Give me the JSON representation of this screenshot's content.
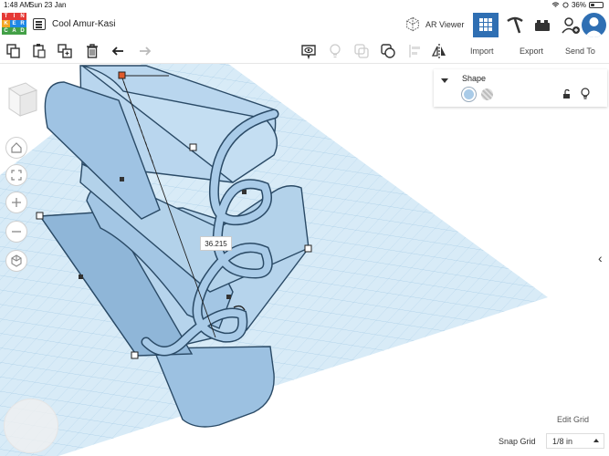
{
  "status_bar": {
    "time": "1:48 AM",
    "date": "Sun 23 Jan",
    "battery": "36%",
    "battery_level": 0.36
  },
  "header": {
    "logo_letters": [
      "T",
      "I",
      "N",
      "K",
      "E",
      "R",
      "C",
      "A",
      "D"
    ],
    "design_name": "Cool Amur-Kasi",
    "ar_viewer_label": "AR Viewer"
  },
  "toolbar": {
    "import_label": "Import",
    "export_label": "Export",
    "send_to_label": "Send To"
  },
  "shape_panel": {
    "title": "Shape"
  },
  "workplane": {
    "measurement": "36.215",
    "edit_grid_label": "Edit Grid",
    "snap_grid_label": "Snap Grid",
    "snap_grid_value": "1/8 in"
  },
  "colors": {
    "accent": "#2f6fb3",
    "shape_fill": "#a9cbe8",
    "grid": "#cfe6f5",
    "logo": [
      "#e53935",
      "#e53935",
      "#e53935",
      "#f5a623",
      "#1e88e5",
      "#1e88e5",
      "#43a047",
      "#43a047",
      "#43a047"
    ]
  }
}
